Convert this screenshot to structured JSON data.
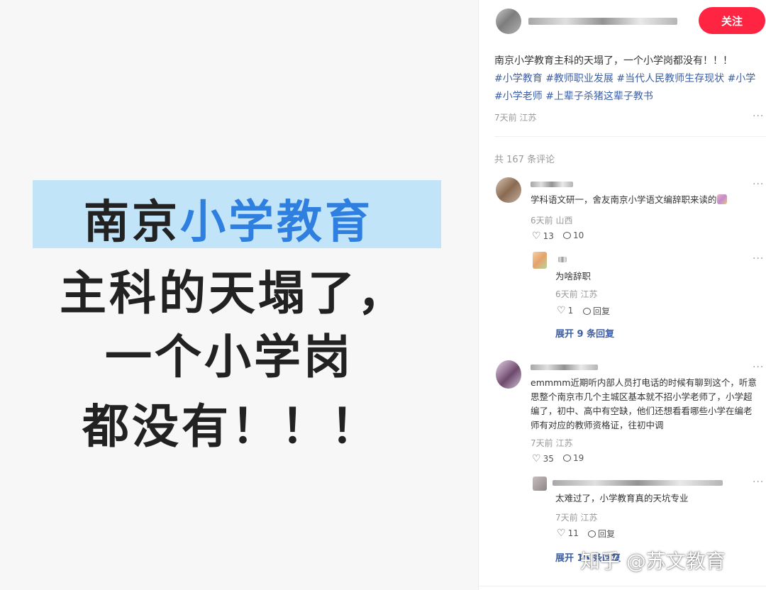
{
  "image": {
    "line1_a": "南京",
    "line1_b": "小学教育",
    "line2": "主科的天塌了，",
    "line3": "一个小学岗",
    "line4": "都没有！！！"
  },
  "post": {
    "follow_label": "关注",
    "title": "南京小学教育主科的天塌了，一个小学岗都没有！！！",
    "tags": [
      "#小学教育",
      "#教师职业发展",
      "#当代人民教师生存现状",
      "#小学",
      "#小学老师",
      "#上辈子杀猪这辈子教书"
    ],
    "meta": "7天前 江苏",
    "comment_count": "共 167 条评论"
  },
  "comments": [
    {
      "text": "学科语文研一，舍友南京小学语文编辞职来读的",
      "meta": "6天前 山西",
      "likes": "13",
      "replies": "10",
      "reply": {
        "text": "为啥辞职",
        "meta": "6天前 江苏",
        "likes": "1",
        "reply_label": "回复"
      },
      "expand": "展开 9 条回复"
    },
    {
      "text": "emmmm近期听内部人员打电话的时候有聊到这个，听意思整个南京市几个主城区基本就不招小学老师了，小学超编了，初中、高中有空缺，他们还想看看哪些小学在编老师有对应的教师资格证，往初中调",
      "meta": "7天前 江苏",
      "likes": "35",
      "replies": "19",
      "reply": {
        "text": "太难过了，小学教育真的天坑专业",
        "meta": "7天前 江苏",
        "likes": "11",
        "reply_label": "回复"
      },
      "expand": "展开 15 条回复"
    }
  ],
  "watermark": "知乎 @苏文教育",
  "colors": {
    "accent": "#ff2442",
    "tag": "#3b5fa8",
    "highlight": "#bfe3f8",
    "title_blue": "#2f7fe0"
  }
}
